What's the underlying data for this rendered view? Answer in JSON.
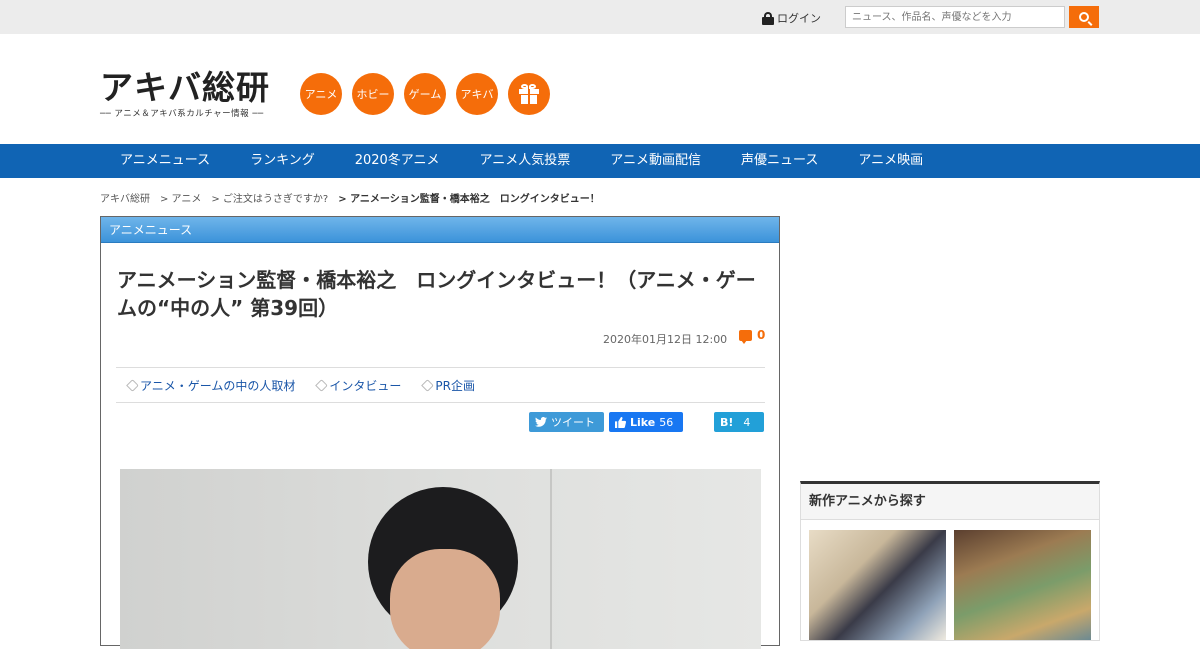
{
  "topbar": {
    "login_label": "ログイン",
    "search_placeholder": "ニュース、作品名、声優などを入力"
  },
  "header": {
    "logo_main": "アキバ総研",
    "logo_sub": "── アニメ＆アキバ系カルチャー情報 ──",
    "categories": [
      "アニメ",
      "ホビー",
      "ゲーム",
      "アキバ"
    ]
  },
  "nav": {
    "items": [
      "アニメニュース",
      "ランキング",
      "2020冬アニメ",
      "アニメ人気投票",
      "アニメ動画配信",
      "声優ニュース",
      "アニメ映画"
    ]
  },
  "breadcrumb": [
    "アキバ総研",
    "> アニメ",
    "> ご注文はうさぎですか?",
    "> アニメーション監督・橋本裕之　ロングインタビュー！"
  ],
  "article": {
    "section": "アニメニュース",
    "title": "アニメーション監督・橋本裕之　ロングインタビュー！（アニメ・ゲームの“中の人” 第39回）",
    "date": "2020年01月12日 12:00",
    "comment_count": "0",
    "tags": [
      "アニメ・ゲームの中の人取材",
      "インタビュー",
      "PR企画"
    ],
    "share": {
      "tweet_label": "ツイート",
      "like_label": "Like",
      "like_count": "56",
      "hatena_label": "B!",
      "hatena_count": "4"
    }
  },
  "sidebar": {
    "heading": "新作アニメから探す"
  },
  "colors": {
    "accent": "#f56d0a",
    "nav": "#1064b4",
    "section_header": "#4a9de0",
    "link": "#1a56a8"
  }
}
